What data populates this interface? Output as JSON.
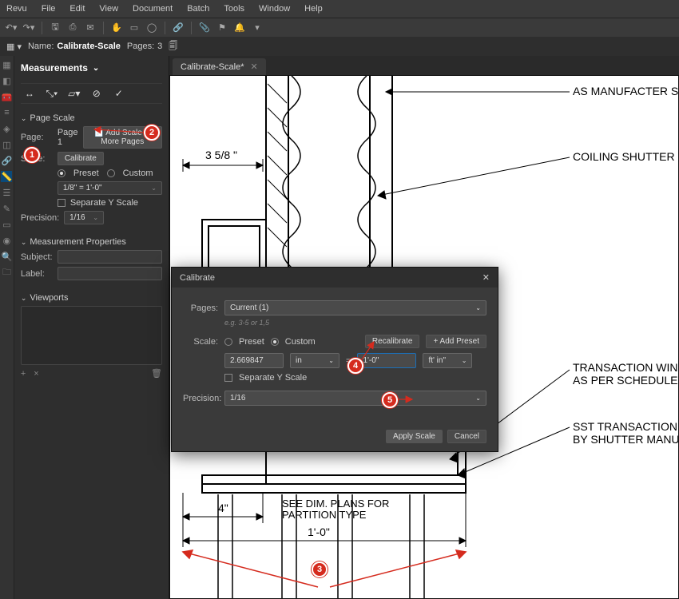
{
  "menu": {
    "items": [
      "Revu",
      "File",
      "Edit",
      "View",
      "Document",
      "Batch",
      "Tools",
      "Window",
      "Help"
    ]
  },
  "docbar": {
    "name_lbl": "Name:",
    "name": "Calibrate-Scale",
    "pages_lbl": "Pages:",
    "pages": "3"
  },
  "panel": {
    "title": "Measurements",
    "page_scale": "Page Scale",
    "page_lbl": "Page:",
    "page_val": "Page 1",
    "add_scale": "Add Scale to More Pages",
    "scale_lbl": "Scale:",
    "calibrate": "Calibrate",
    "preset": "Preset",
    "custom": "Custom",
    "scale_sel": "1/8\" = 1'-0\"",
    "sep_y": "Separate Y Scale",
    "precision_lbl": "Precision:",
    "precision": "1/16",
    "meas_props": "Measurement Properties",
    "subject": "Subject:",
    "label": "Label:",
    "viewports": "Viewports",
    "plus": "+",
    "times": "×",
    "trash": "🗑"
  },
  "tab": {
    "name": "Calibrate-Scale*"
  },
  "drawing": {
    "dim_top": "3 5/8 \"",
    "note1": "AS MANUFACTER SP",
    "note2": "COILING SHUTTER",
    "note3a": "TRANSACTION WIND",
    "note3b": "AS PER SCHEDULE",
    "note4a": "SST TRANSACTION C",
    "note4b": "BY SHUTTER MANUF",
    "dim_4in": "4\"",
    "dim_note_a": "SEE DIM. PLANS FOR",
    "dim_note_b": "PARTITION TYPE",
    "dim_1ft": "1'-0\""
  },
  "dialog": {
    "title": "Calibrate",
    "pages_lbl": "Pages:",
    "pages": "Current (1)",
    "pages_hint": "e.g. 3-5 or 1,5",
    "scale_lbl": "Scale:",
    "preset": "Preset",
    "custom": "Custom",
    "recal": "Recalibrate",
    "add_preset": "+ Add Preset",
    "from_val": "2.669847",
    "from_unit": "in",
    "eq": "=",
    "to_val": "1'-0\"",
    "to_unit": "ft' in\"",
    "sep_y": "Separate Y Scale",
    "precision_lbl": "Precision:",
    "precision": "1/16",
    "apply": "Apply Scale",
    "cancel": "Cancel"
  },
  "badges": {
    "b1": "1",
    "b2": "2",
    "b3": "3",
    "b4": "4",
    "b5": "5"
  }
}
